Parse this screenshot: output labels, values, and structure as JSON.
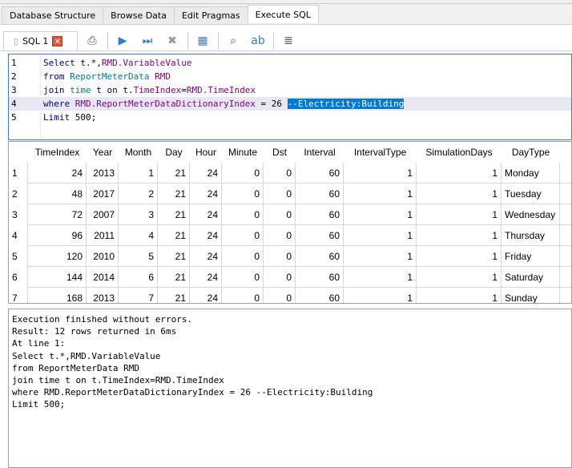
{
  "tabs": [
    "Database Structure",
    "Browse Data",
    "Edit Pragmas",
    "Execute SQL"
  ],
  "active_tab": "Execute SQL",
  "toolbar": {
    "icons": [
      "open-tab-icon",
      "open-sql-icon",
      "save-sql-icon",
      "print-icon",
      "execute-all-icon",
      "execute-line-icon",
      "stop-icon",
      "save-results-icon",
      "find-icon",
      "find-replace-icon",
      "comment-icon"
    ]
  },
  "editor_tab": {
    "label": "SQL 1",
    "close": "✕"
  },
  "editor": {
    "lines": [
      {
        "num": "1",
        "parts": [
          [
            "kw",
            "Select "
          ],
          [
            "",
            "t.*,"
          ],
          [
            "id",
            "RMD.VariableValue"
          ]
        ]
      },
      {
        "num": "2",
        "parts": [
          [
            "kw",
            "from "
          ],
          [
            "tb2",
            "ReportMeterData "
          ],
          [
            "id",
            "RMD"
          ]
        ]
      },
      {
        "num": "3",
        "parts": [
          [
            "kw",
            "join "
          ],
          [
            "tb2",
            "time "
          ],
          [
            "",
            "t "
          ],
          [
            "kw",
            "on "
          ],
          [
            "",
            "t."
          ],
          [
            "id",
            "TimeIndex"
          ],
          [
            "",
            "="
          ],
          [
            "id",
            "RMD.TimeIndex"
          ]
        ]
      },
      {
        "num": "4",
        "parts": [
          [
            "kw",
            "where "
          ],
          [
            "id",
            "RMD.ReportMeterDataDictionaryIndex "
          ],
          [
            "",
            "= 26 "
          ],
          [
            "sel",
            "--Electricity:Building"
          ]
        ]
      },
      {
        "num": "5",
        "parts": [
          [
            "kw",
            "Limit "
          ],
          [
            "",
            "500;"
          ]
        ]
      }
    ]
  },
  "results": {
    "columns": [
      "TimeIndex",
      "Year",
      "Month",
      "Day",
      "Hour",
      "Minute",
      "Dst",
      "Interval",
      "IntervalType",
      "SimulationDays",
      "DayType",
      ""
    ],
    "rows": [
      [
        "1",
        "24",
        "2013",
        "1",
        "21",
        "24",
        "0",
        "0",
        "60",
        "1",
        "1",
        "Monday"
      ],
      [
        "2",
        "48",
        "2017",
        "2",
        "21",
        "24",
        "0",
        "0",
        "60",
        "1",
        "1",
        "Tuesday"
      ],
      [
        "3",
        "72",
        "2007",
        "3",
        "21",
        "24",
        "0",
        "0",
        "60",
        "1",
        "1",
        "Wednesday"
      ],
      [
        "4",
        "96",
        "2011",
        "4",
        "21",
        "24",
        "0",
        "0",
        "60",
        "1",
        "1",
        "Thursday"
      ],
      [
        "5",
        "120",
        "2010",
        "5",
        "21",
        "24",
        "0",
        "0",
        "60",
        "1",
        "1",
        "Friday"
      ],
      [
        "6",
        "144",
        "2014",
        "6",
        "21",
        "24",
        "0",
        "0",
        "60",
        "1",
        "1",
        "Saturday"
      ],
      [
        "7",
        "168",
        "2013",
        "7",
        "21",
        "24",
        "0",
        "0",
        "60",
        "1",
        "1",
        "Sunday"
      ]
    ]
  },
  "message": "Execution finished without errors.\nResult: 12 rows returned in 6ms\nAt line 1:\nSelect t.*,RMD.VariableValue\nfrom ReportMeterData RMD\njoin time t on t.TimeIndex=RMD.TimeIndex\nwhere RMD.ReportMeterDataDictionaryIndex = 26 --Electricity:Building\nLimit 500;"
}
